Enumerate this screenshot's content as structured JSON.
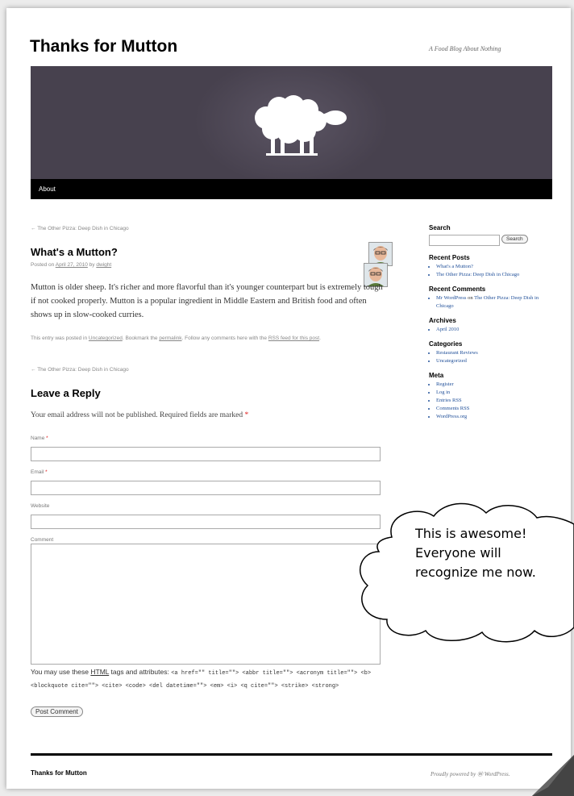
{
  "site": {
    "title": "Thanks for Mutton",
    "tagline": "A Food Blog About Nothing"
  },
  "nav": {
    "about": "About"
  },
  "post": {
    "prev_link": "← The Other Pizza: Deep Dish in Chicago",
    "title": "What's a Mutton?",
    "meta_prefix": "Posted on ",
    "date": "April 27, 2010",
    "meta_by": " by ",
    "author": "dwight",
    "body": "Mutton is older sheep. It's richer and more flavorful than it's younger counterpart but is extremely tough if not cooked properly. Mutton is a popular ingredient in Middle Eastern and British food and often shows up in slow-cooked curries.",
    "footer_1": "This entry was posted in ",
    "category": "Uncategorized",
    "footer_2": ". Bookmark the ",
    "permalink": "permalink",
    "footer_3": ". Follow any comments here with the ",
    "rss": "RSS feed for this post",
    "footer_4": ".",
    "prev_link_bottom": "← The Other Pizza: Deep Dish in Chicago"
  },
  "reply": {
    "heading": "Leave a Reply",
    "notes": "Your email address will not be published. Required fields are marked",
    "required_mark": "*",
    "name_label": "Name",
    "email_label": "Email",
    "website_label": "Website",
    "comment_label": "Comment",
    "tags_prefix": "You may use these ",
    "tags_html": "HTML",
    "tags_suffix": " tags and attributes: ",
    "tags_code": "<a href=\"\" title=\"\"> <abbr title=\"\"> <acronym title=\"\"> <b> <blockquote cite=\"\"> <cite> <code> <del datetime=\"\"> <em> <i> <q cite=\"\"> <strike> <strong>",
    "submit": "Post Comment"
  },
  "sidebar": {
    "search_title": "Search",
    "search_button": "Search",
    "recent_posts_title": "Recent Posts",
    "recent_posts": [
      "What's a Mutton?",
      "The Other Pizza: Deep Dish in Chicago"
    ],
    "recent_comments_title": "Recent Comments",
    "recent_comment_author": "Mr WordPress",
    "recent_comment_on": " on ",
    "recent_comment_post": "The Other Pizza: Deep Dish in Chicago",
    "archives_title": "Archives",
    "archives": [
      "April 2010"
    ],
    "categories_title": "Categories",
    "categories": [
      "Restaurant Reviews",
      "Uncategorized"
    ],
    "meta_title": "Meta",
    "meta": [
      "Register",
      "Log in",
      "Entries RSS",
      "Comments RSS",
      "WordPress.org"
    ]
  },
  "footer": {
    "title": "Thanks for Mutton",
    "credit": "Proudly powered by Ⓦ WordPress."
  },
  "callout": {
    "lines": [
      "This is awesome!",
      "Everyone will",
      "recognize me now."
    ]
  },
  "colors": {
    "banner": "#47414e",
    "link": "#22519a",
    "required": "#e02020"
  }
}
